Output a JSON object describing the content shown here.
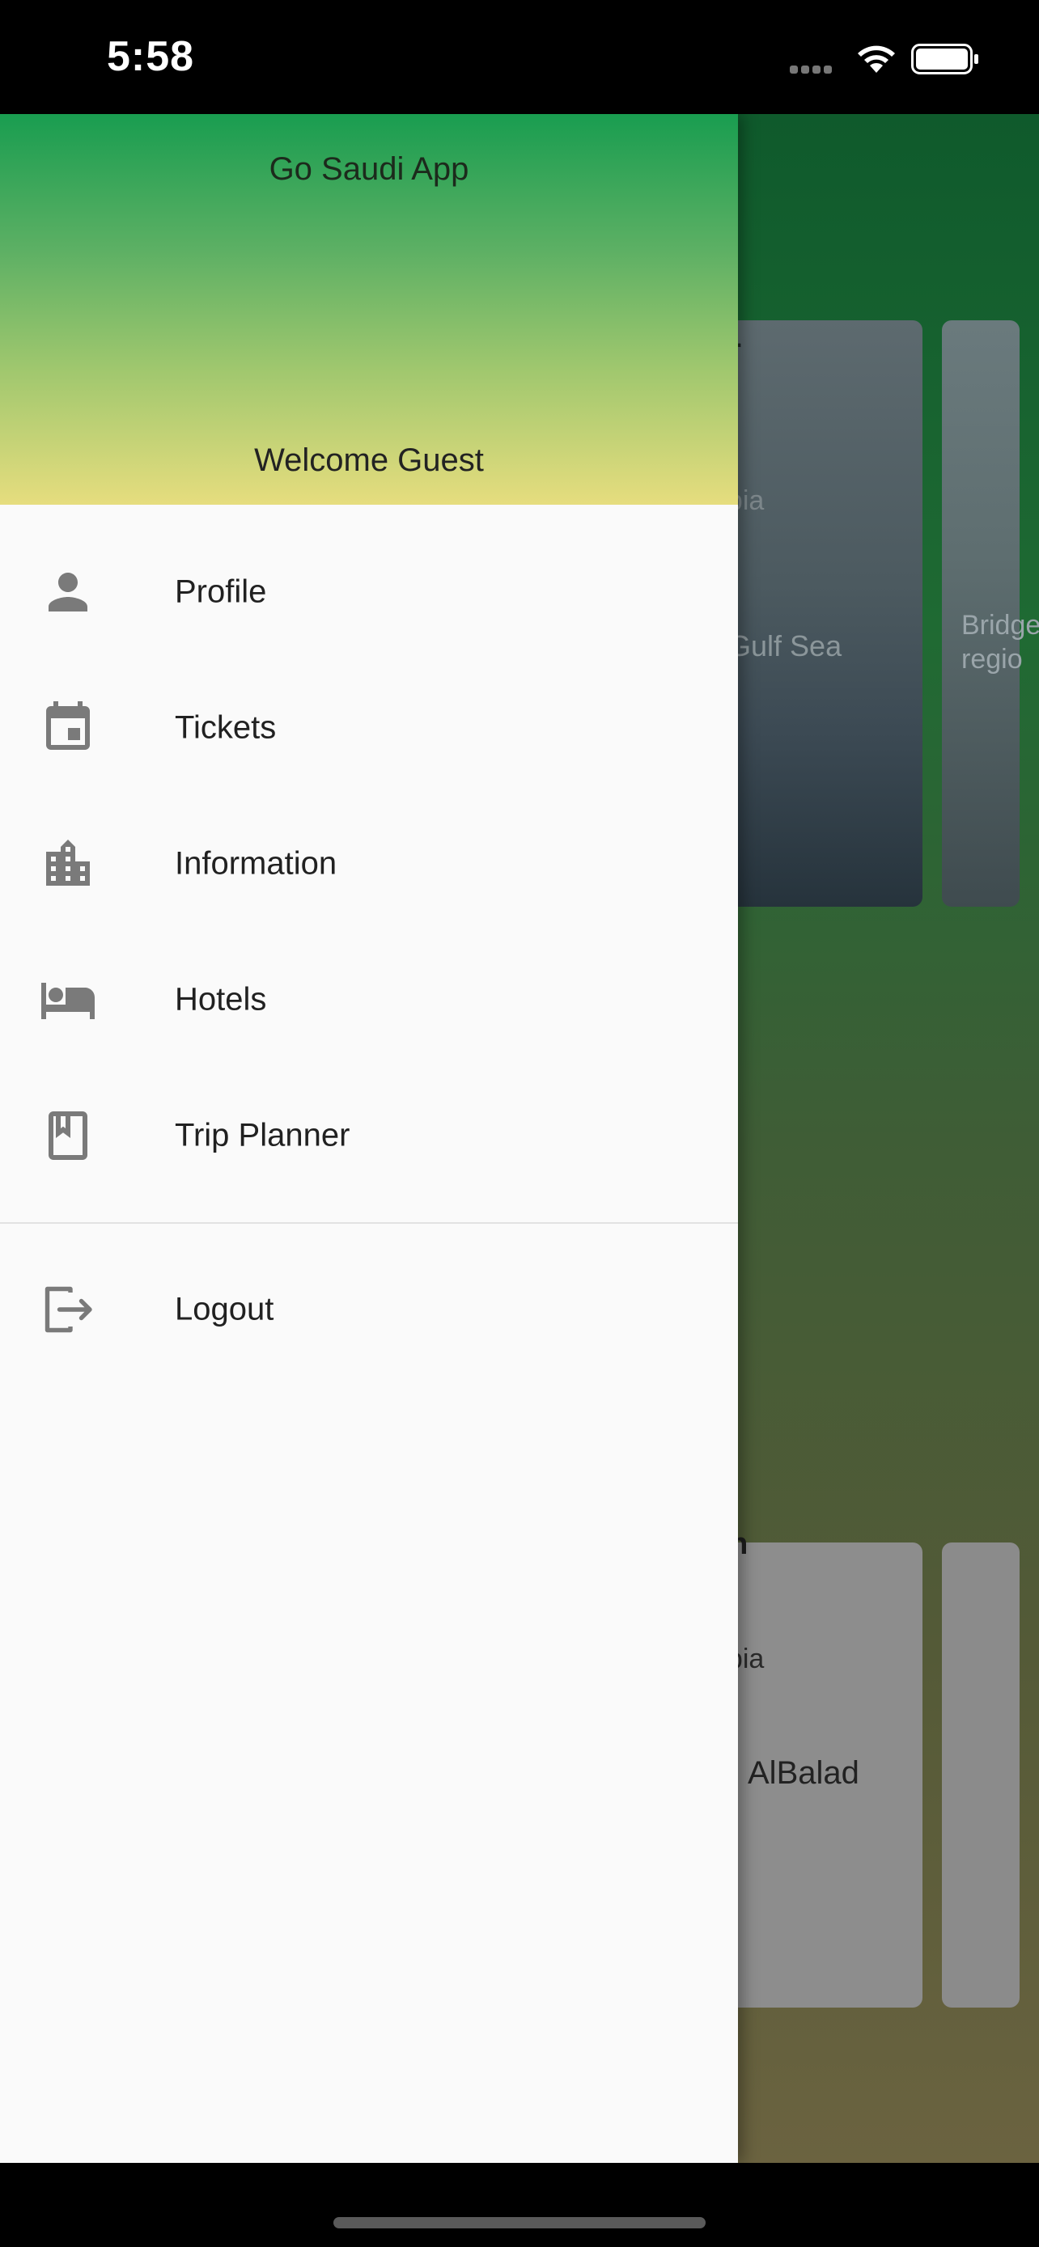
{
  "status_bar": {
    "time": "5:58"
  },
  "drawer": {
    "app_title": "Go Saudi App",
    "welcome": "Welcome Guest",
    "items": [
      {
        "label": "Profile",
        "icon": "person-icon"
      },
      {
        "label": "Tickets",
        "icon": "calendar-icon"
      },
      {
        "label": "Information",
        "icon": "building-icon"
      },
      {
        "label": "Hotels",
        "icon": "bed-icon"
      },
      {
        "label": "Trip Planner",
        "icon": "book-icon"
      }
    ],
    "logout": {
      "label": "Logout",
      "icon": "logout-icon"
    }
  },
  "background": {
    "card1": {
      "name": "ar",
      "country": "abia",
      "desc": ", Gulf Sea"
    },
    "card2": {
      "desc": "Bridge regio"
    },
    "card3": {
      "name": "ah",
      "country": "abia",
      "desc": "AlBalad"
    }
  },
  "colors": {
    "header_top": "#199d50",
    "header_bottom": "#e6dd7e",
    "drawer_bg": "#fafafa",
    "icon_gray": "#7a7a7a"
  }
}
